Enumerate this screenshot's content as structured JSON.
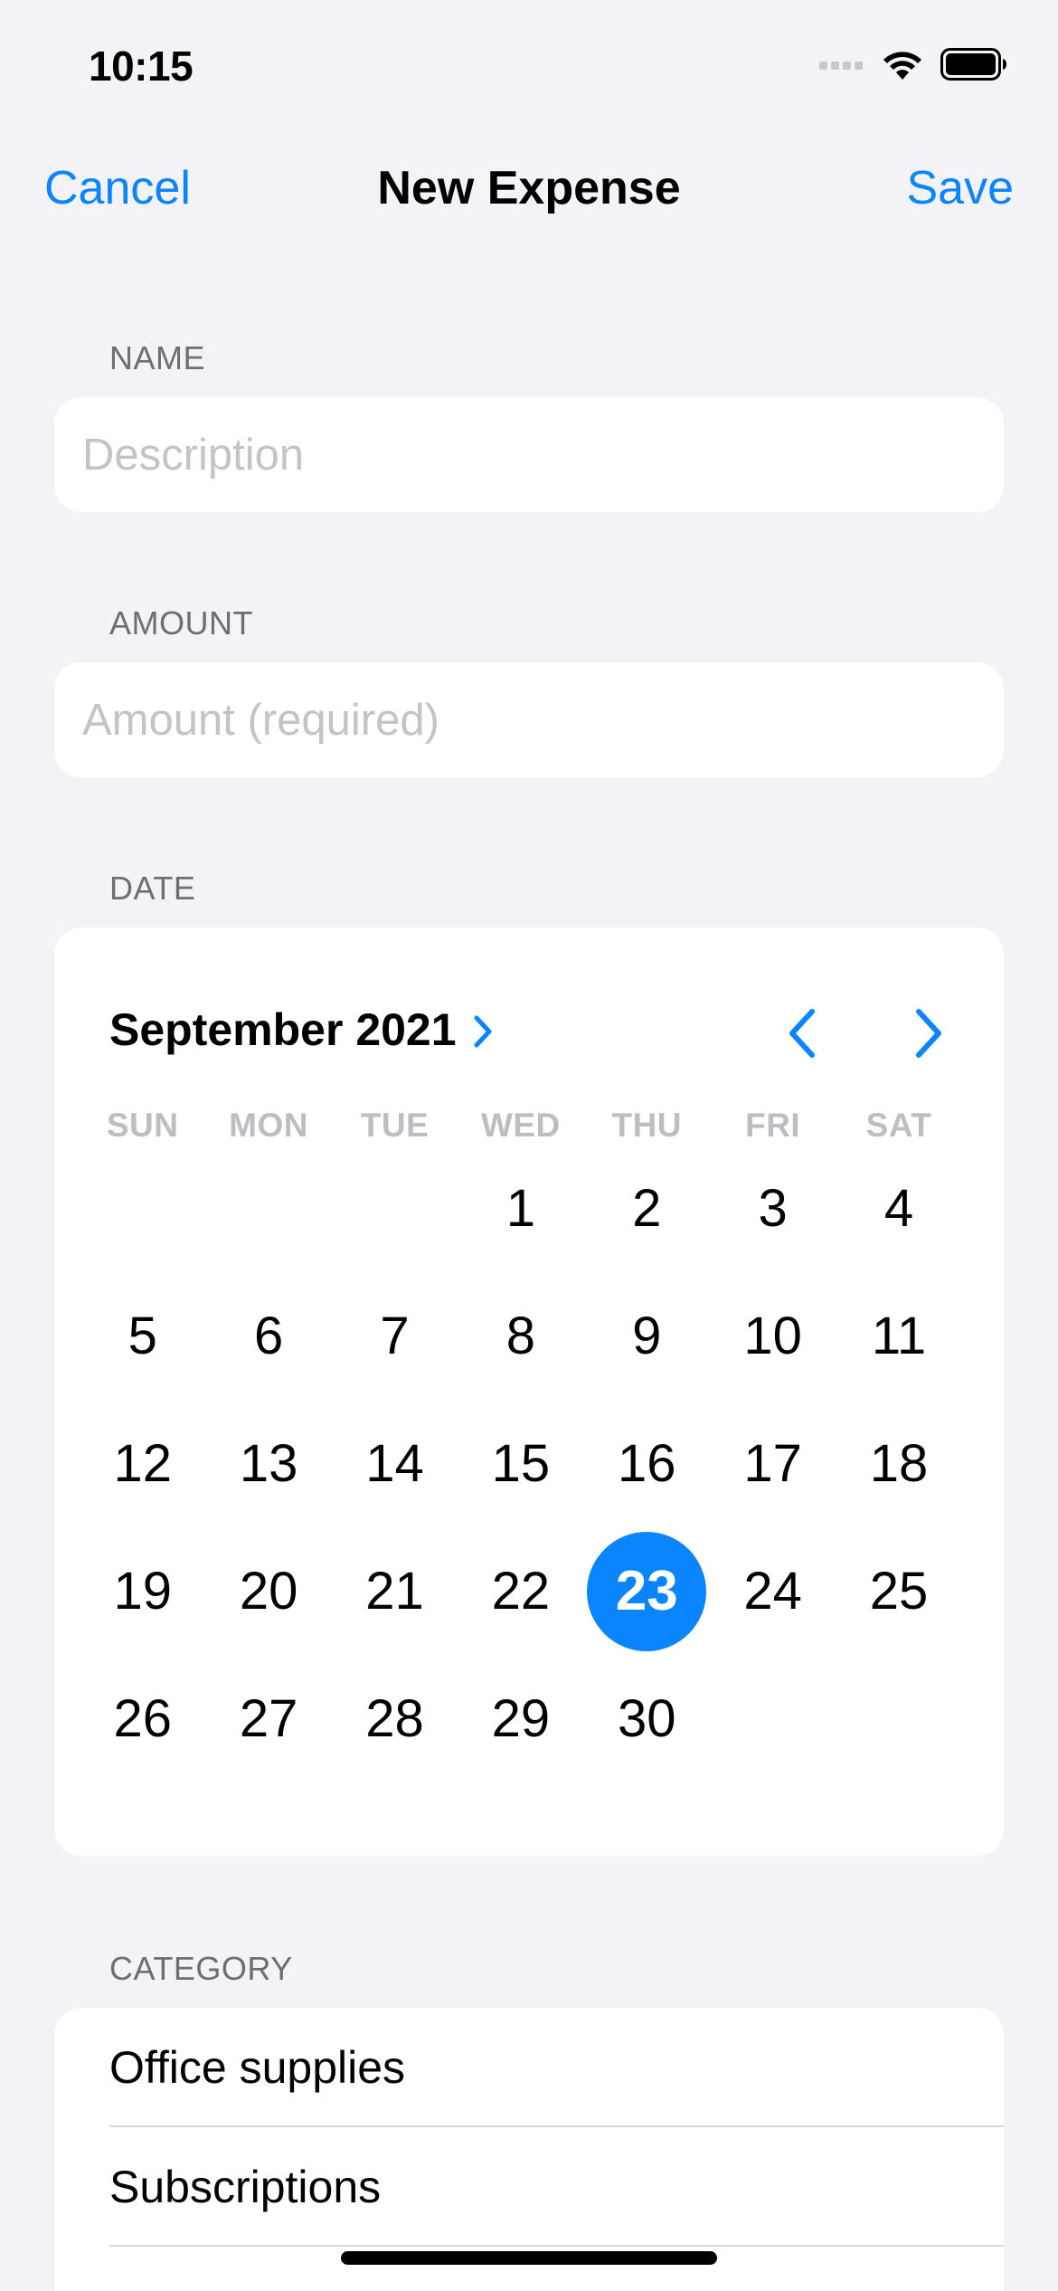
{
  "status_bar": {
    "time": "10:15"
  },
  "nav": {
    "cancel_label": "Cancel",
    "title": "New Expense",
    "save_label": "Save"
  },
  "name_section": {
    "header": "NAME",
    "placeholder": "Description",
    "value": ""
  },
  "amount_section": {
    "header": "AMOUNT",
    "placeholder": "Amount (required)",
    "value": ""
  },
  "date_section": {
    "header": "DATE",
    "month_label": "September 2021",
    "weekdays": [
      "SUN",
      "MON",
      "TUE",
      "WED",
      "THU",
      "FRI",
      "SAT"
    ],
    "days": [
      "1",
      "2",
      "3",
      "4",
      "5",
      "6",
      "7",
      "8",
      "9",
      "10",
      "11",
      "12",
      "13",
      "14",
      "15",
      "16",
      "17",
      "18",
      "19",
      "20",
      "21",
      "22",
      "23",
      "24",
      "25",
      "26",
      "27",
      "28",
      "29",
      "30"
    ],
    "selected_day": "23"
  },
  "category_section": {
    "header": "CATEGORY",
    "items": [
      {
        "label": "Office supplies"
      },
      {
        "label": "Subscriptions"
      }
    ]
  },
  "colors": {
    "accent": "#0A84FF",
    "background": "#F2F2F7"
  }
}
